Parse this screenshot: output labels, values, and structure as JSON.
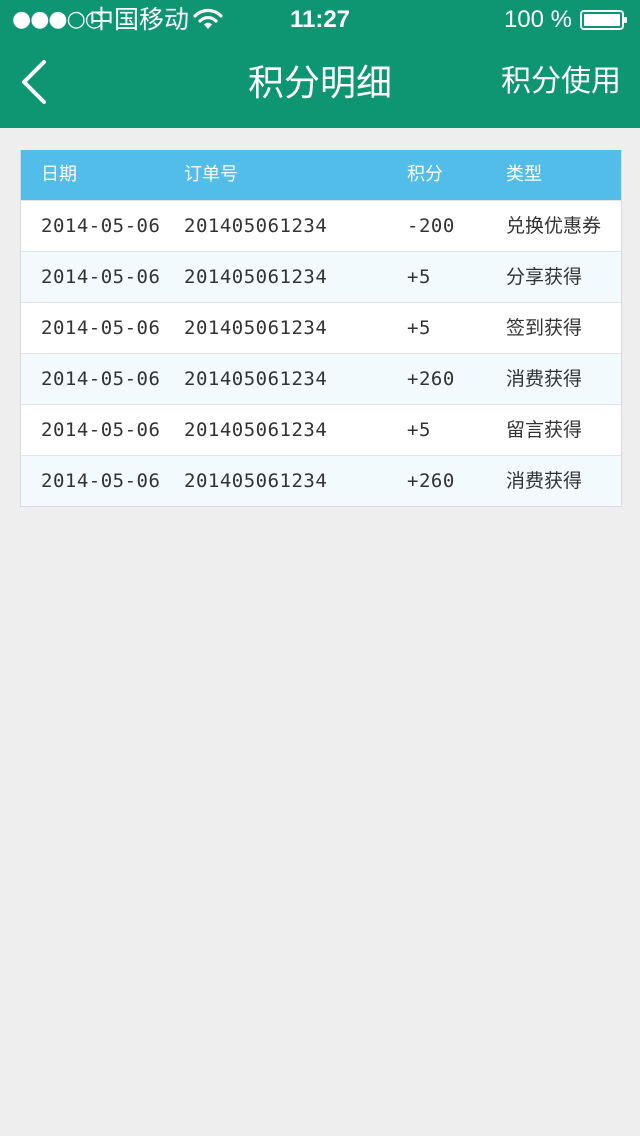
{
  "status_bar": {
    "signal": "●●●○○",
    "carrier": "中国移动",
    "time": "11:27",
    "battery_percent": "100 %"
  },
  "nav": {
    "title": "积分明细",
    "action": "积分使用"
  },
  "table": {
    "headers": [
      "日期",
      "订单号",
      "积分",
      "类型"
    ],
    "rows": [
      {
        "date": "2014-05-06",
        "order": "201405061234",
        "points": "-200",
        "type": "兑换优惠券"
      },
      {
        "date": "2014-05-06",
        "order": "201405061234",
        "points": "+5",
        "type": "分享获得"
      },
      {
        "date": "2014-05-06",
        "order": "201405061234",
        "points": "+5",
        "type": "签到获得"
      },
      {
        "date": "2014-05-06",
        "order": "201405061234",
        "points": "+260",
        "type": "消费获得"
      },
      {
        "date": "2014-05-06",
        "order": "201405061234",
        "points": "+5",
        "type": "留言获得"
      },
      {
        "date": "2014-05-06",
        "order": "201405061234",
        "points": "+260",
        "type": "消费获得"
      }
    ]
  },
  "colors": {
    "header_bg": "#0e9673",
    "table_header_bg": "#52bde9",
    "page_bg": "#eeeeee",
    "alt_row_bg": "#f2fafd"
  }
}
